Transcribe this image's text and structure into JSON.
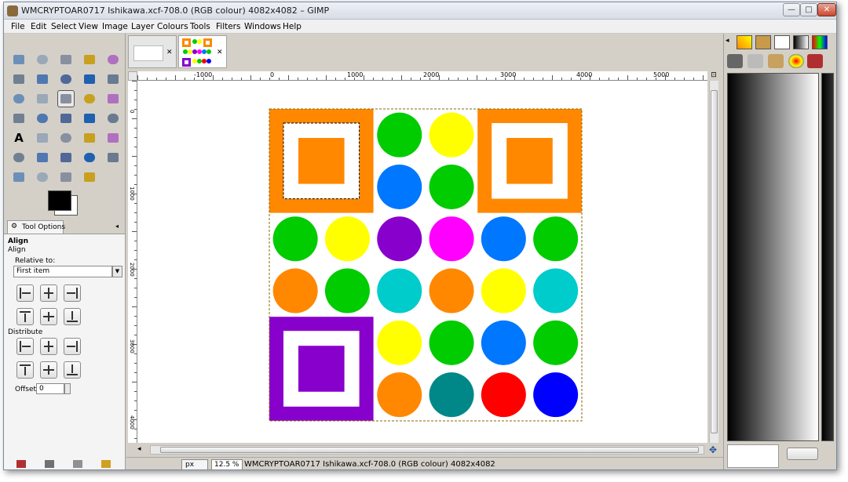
{
  "window": {
    "title": "WMCRYPTOAR0717 Ishikawa.xcf-708.0 (RGB colour) 4082x4082 – GIMP",
    "buttons": {
      "minimize": "—",
      "maximize": "□",
      "close": "✕"
    }
  },
  "menu": [
    "File",
    "Edit",
    "Select",
    "View",
    "Image",
    "Layer",
    "Colours",
    "Tools",
    "Filters",
    "Windows",
    "Help"
  ],
  "toolbox": {
    "tools": [
      "rect-select",
      "ellipse-select",
      "free-select",
      "fuzzy-select",
      "by-color-select",
      "scissors-select",
      "foreground-select",
      "paths",
      "color-picker",
      "zoom",
      "measure",
      "move",
      "align",
      "crop",
      "rotate",
      "scale",
      "shear",
      "perspective",
      "flip",
      "cage",
      "text",
      "bucket-fill",
      "blend",
      "pencil",
      "paintbrush",
      "eraser",
      "airbrush",
      "ink",
      "clone",
      "heal",
      "perspective-clone",
      "blur",
      "smudge",
      "dodge-burn"
    ]
  },
  "tool_options": {
    "tab_label": "Tool Options",
    "heading": "Align",
    "subheading": "Align",
    "relative_label": "Relative to:",
    "relative_value": "First item",
    "distribute_label": "Distribute",
    "offset_label": "Offset:",
    "offset_value": "0"
  },
  "ruler": {
    "top_labels": [
      "-1000",
      "0",
      "1000",
      "2000",
      "3000",
      "4000",
      "5000"
    ],
    "left_labels": [
      "0",
      "1000",
      "2000",
      "3000",
      "4000"
    ]
  },
  "status": {
    "unit": "px",
    "zoom": "12.5 %",
    "text": "WMCRYPTOAR0717 Ishikawa.xcf-708.0 (RGB colour) 4082x4082"
  },
  "image": {
    "colors": {
      "orange": "#ff8800",
      "green": "#00cc00",
      "yellow": "#ffff00",
      "blue": "#0077ff",
      "purple": "#8800cc",
      "magenta": "#ff00ff",
      "cyan": "#00cccc",
      "teal": "#008888",
      "red": "#ff0000",
      "navy": "#0000ff"
    },
    "circles": [
      {
        "row": 0,
        "col": 2,
        "color": "#00cc00"
      },
      {
        "row": 0,
        "col": 3,
        "color": "#ffff00"
      },
      {
        "row": 1,
        "col": 2,
        "color": "#0077ff"
      },
      {
        "row": 1,
        "col": 3,
        "color": "#00cc00"
      },
      {
        "row": 2,
        "col": 0,
        "color": "#00cc00"
      },
      {
        "row": 2,
        "col": 1,
        "color": "#ffff00"
      },
      {
        "row": 2,
        "col": 2,
        "color": "#8800cc"
      },
      {
        "row": 2,
        "col": 3,
        "color": "#ff00ff"
      },
      {
        "row": 2,
        "col": 4,
        "color": "#0077ff"
      },
      {
        "row": 2,
        "col": 5,
        "color": "#00cc00"
      },
      {
        "row": 3,
        "col": 0,
        "color": "#ff8800"
      },
      {
        "row": 3,
        "col": 1,
        "color": "#00cc00"
      },
      {
        "row": 3,
        "col": 2,
        "color": "#00cccc"
      },
      {
        "row": 3,
        "col": 3,
        "color": "#ff8800"
      },
      {
        "row": 3,
        "col": 4,
        "color": "#ffff00"
      },
      {
        "row": 3,
        "col": 5,
        "color": "#00cccc"
      },
      {
        "row": 4,
        "col": 2,
        "color": "#ffff00"
      },
      {
        "row": 4,
        "col": 3,
        "color": "#00cc00"
      },
      {
        "row": 4,
        "col": 4,
        "color": "#0077ff"
      },
      {
        "row": 4,
        "col": 5,
        "color": "#00cc00"
      },
      {
        "row": 5,
        "col": 2,
        "color": "#ff8800"
      },
      {
        "row": 5,
        "col": 3,
        "color": "#008888"
      },
      {
        "row": 5,
        "col": 4,
        "color": "#ff0000"
      },
      {
        "row": 5,
        "col": 5,
        "color": "#0000ff"
      }
    ],
    "squares": [
      {
        "row": 0,
        "col": 0,
        "color": "#ff8800"
      },
      {
        "row": 0,
        "col": 4,
        "color": "#ff8800"
      },
      {
        "row": 4,
        "col": 0,
        "color": "#8800cc"
      }
    ]
  }
}
